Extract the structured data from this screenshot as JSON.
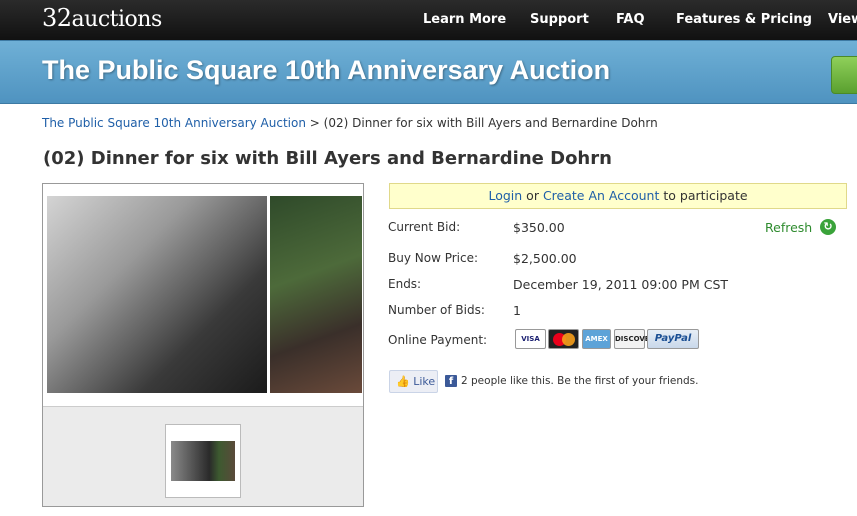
{
  "brand": {
    "logo_num": "32",
    "logo_text": "auctions"
  },
  "nav": {
    "learn_more": "Learn More",
    "support": "Support",
    "faq": "FAQ",
    "features": "Features & Pricing",
    "view": "View"
  },
  "banner": {
    "title": "The Public Square 10th Anniversary Auction"
  },
  "breadcrumb": {
    "parent": "The Public Square 10th Anniversary Auction",
    "separator": ">",
    "current": "(02) Dinner for six with Bill Ayers and Bernardine Dohrn"
  },
  "item": {
    "title": "(02) Dinner for six with Bill Ayers and Bernardine Dohrn"
  },
  "login": {
    "login_link": "Login",
    "or": "or",
    "create_link": "Create An Account",
    "suffix": "to participate"
  },
  "details": {
    "current_bid_label": "Current Bid:",
    "current_bid": "$350.00",
    "refresh_label": "Refresh",
    "buy_now_label": "Buy Now Price:",
    "buy_now": "$2,500.00",
    "ends_label": "Ends:",
    "ends": "December 19, 2011 09:00 PM CST",
    "bids_label": "Number of Bids:",
    "bids": "1",
    "payment_label": "Online Payment:"
  },
  "payment_cards": {
    "visa": "VISA",
    "mastercard": "MasterCard",
    "amex": "AMEX",
    "discover": "DISCOVER",
    "paypal": "PayPal"
  },
  "facebook": {
    "like_label": "Like",
    "text": "2 people like this. Be the first of your friends."
  },
  "colors": {
    "topbar": "#1b1b1b",
    "banner": "#5aa0cc",
    "link": "#1f5fa8",
    "login_bg": "#ffffcc",
    "refresh": "#2e8b2e"
  }
}
